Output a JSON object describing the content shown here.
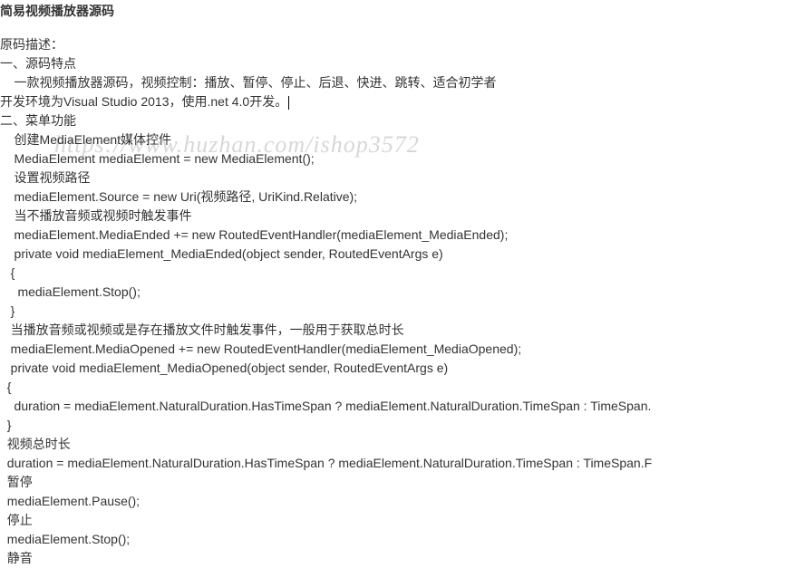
{
  "title": "简易视频播放器源码",
  "watermark": "https://www.huzhan.com/ishop3572",
  "sections": {
    "desc_header": "原码描述：",
    "s1_header": "一、源码特点",
    "s1_line1": "    一款视频播放器源码，视频控制：播放、暂停、停止、后退、快进、跳转、适合初学者",
    "s1_line2": "开发环境为Visual Studio 2013，使用.net 4.0开发。",
    "s2_header": "二、菜单功能",
    "lines": [
      "    创建MediaElement媒体控件",
      "    MediaElement mediaElement = new MediaElement();",
      "    设置视频路径",
      "    mediaElement.Source = new Uri(视频路径, UriKind.Relative);",
      "    当不播放音频或视频时触发事件",
      "    mediaElement.MediaEnded += new RoutedEventHandler(mediaElement_MediaEnded);",
      "    private void mediaElement_MediaEnded(object sender, RoutedEventArgs e)",
      "   {",
      "     mediaElement.Stop();",
      "   }",
      "   当播放音频或视频或是存在播放文件时触发事件，一般用于获取总时长",
      "   mediaElement.MediaOpened += new RoutedEventHandler(mediaElement_MediaOpened);",
      "   private void mediaElement_MediaOpened(object sender, RoutedEventArgs e)",
      "  {",
      "    duration = mediaElement.NaturalDuration.HasTimeSpan ? mediaElement.NaturalDuration.TimeSpan : TimeSpan.",
      "  }",
      "  视频总时长",
      "  duration = mediaElement.NaturalDuration.HasTimeSpan ? mediaElement.NaturalDuration.TimeSpan : TimeSpan.F",
      "  暂停",
      "  mediaElement.Pause();",
      "  停止",
      "  mediaElement.Stop();",
      "  静音"
    ]
  }
}
